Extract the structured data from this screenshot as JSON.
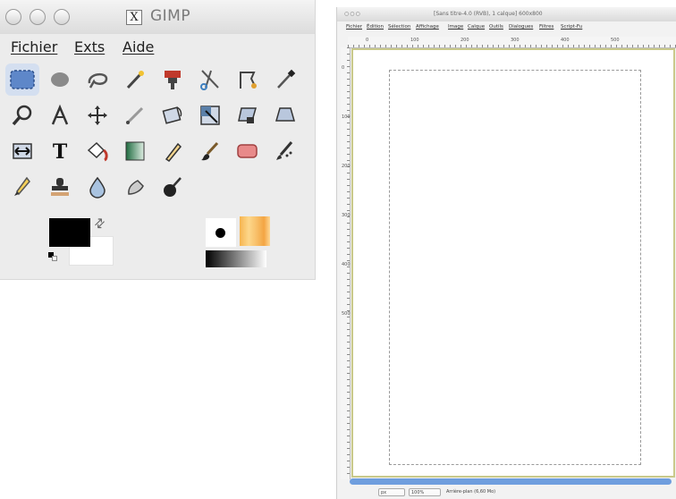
{
  "toolbox": {
    "title": "GIMP",
    "menu": [
      "Fichier",
      "Exts",
      "Aide"
    ],
    "tools": [
      "rect-select-icon",
      "ellipse-select-icon",
      "lasso-select-icon",
      "fuzzy-select-icon",
      "color-select-icon",
      "scissors-icon",
      "paths-icon",
      "color-picker-icon",
      "magnify-icon",
      "measure-icon",
      "move-icon",
      "crop-icon",
      "rotate-icon",
      "scale-icon",
      "shear-icon",
      "perspective-icon",
      "flip-icon",
      "text-icon",
      "bucket-fill-icon",
      "blend-icon",
      "pencil-icon",
      "paintbrush-icon",
      "eraser-icon",
      "airbrush-icon",
      "ink-icon",
      "clone-icon",
      "blur-icon",
      "smudge-icon",
      "dodge-burn-icon"
    ],
    "selected_tool": "rect-select-icon"
  },
  "image_window": {
    "title": "[Sans titre-4.0 (RVB), 1 calque] 600x800",
    "menu": [
      "Fichier",
      "Édition",
      "Sélection",
      "Affichage",
      "Image",
      "Calque",
      "Outils",
      "Dialogues",
      "Filtres",
      "Script-Fu"
    ],
    "ruler_labels": [
      "0",
      "100",
      "200",
      "300",
      "400",
      "500"
    ],
    "status": {
      "unit": "px",
      "zoom": "100%",
      "layer": "Arrière-plan (6,60 Mo)"
    }
  }
}
